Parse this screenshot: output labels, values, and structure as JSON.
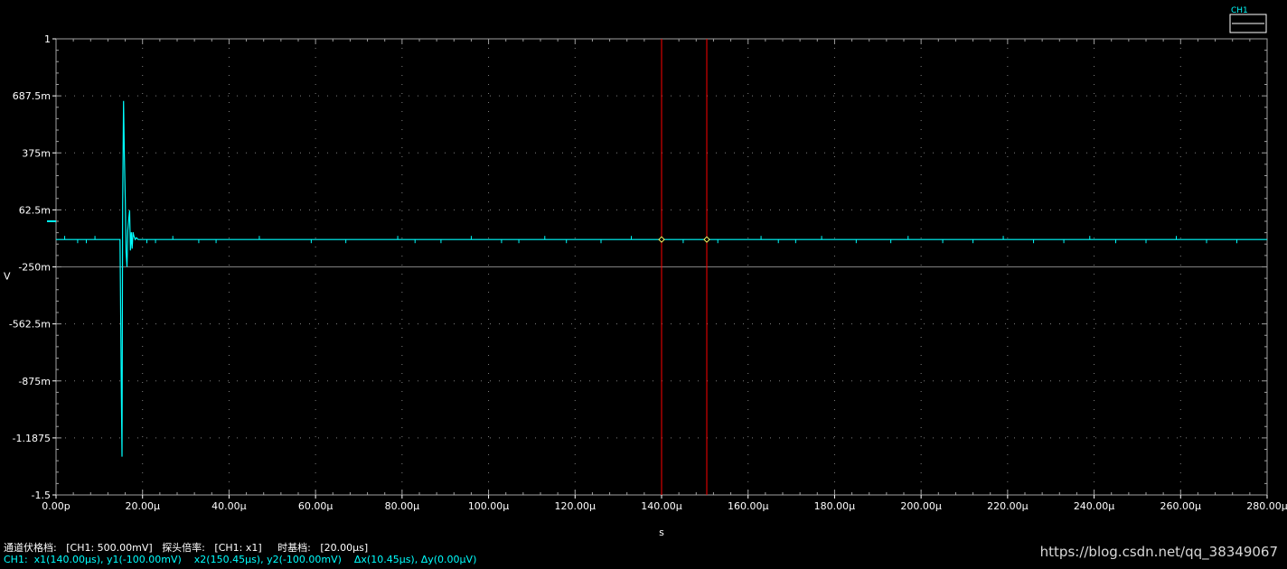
{
  "chart_data": {
    "type": "line",
    "x_unit": "s",
    "y_unit": "V",
    "xlim": [
      0,
      280
    ],
    "ylim": [
      -1.5,
      1
    ],
    "x_ticks": [
      {
        "v": 0,
        "label": "0.00p"
      },
      {
        "v": 20,
        "label": "20.00μ"
      },
      {
        "v": 40,
        "label": "40.00μ"
      },
      {
        "v": 60,
        "label": "60.00μ"
      },
      {
        "v": 80,
        "label": "80.00μ"
      },
      {
        "v": 100,
        "label": "100.00μ"
      },
      {
        "v": 120,
        "label": "120.00μ"
      },
      {
        "v": 140,
        "label": "140.00μ"
      },
      {
        "v": 160,
        "label": "160.00μ"
      },
      {
        "v": 180,
        "label": "180.00μ"
      },
      {
        "v": 200,
        "label": "200.00μ"
      },
      {
        "v": 220,
        "label": "220.00μ"
      },
      {
        "v": 240,
        "label": "240.00μ"
      },
      {
        "v": 260,
        "label": "260.00μ"
      },
      {
        "v": 280,
        "label": "280.00μ"
      }
    ],
    "y_ticks": [
      {
        "v": 1,
        "label": "1"
      },
      {
        "v": 0.6875,
        "label": "687.5m"
      },
      {
        "v": 0.375,
        "label": "375m"
      },
      {
        "v": 0.0625,
        "label": "62.5m"
      },
      {
        "v": -0.25,
        "label": "-250m"
      },
      {
        "v": -0.5625,
        "label": "-562.5m"
      },
      {
        "v": -0.875,
        "label": "-875m"
      },
      {
        "v": -1.1875,
        "label": "-1.1875"
      },
      {
        "v": -1.5,
        "label": "-1.5"
      }
    ],
    "grid": true,
    "series": [
      {
        "name": "CH1",
        "color": "#00ffff",
        "x": [
          0,
          14.8,
          14.95,
          15.1,
          15.25,
          15.4,
          15.6,
          15.8,
          16.0,
          16.2,
          16.4,
          16.6,
          16.8,
          17.0,
          17.2,
          17.4,
          17.6,
          17.8,
          18.0,
          18.3,
          18.6,
          19.0,
          140,
          150.45,
          280
        ],
        "y": [
          -0.1,
          -0.1,
          -0.5,
          -0.95,
          -1.29,
          0.08,
          0.66,
          0.36,
          0.12,
          -0.17,
          -0.25,
          -0.05,
          0.01,
          0.06,
          -0.16,
          -0.06,
          -0.15,
          -0.06,
          -0.08,
          -0.1,
          -0.09,
          -0.1,
          -0.1,
          -0.1,
          -0.1
        ],
        "noise_x": [
          2,
          5,
          7,
          9,
          21,
          23,
          27,
          33,
          37,
          47,
          59,
          67,
          79,
          83,
          89,
          96,
          103,
          107,
          113,
          118,
          126,
          133,
          145,
          153,
          163,
          167,
          171,
          177,
          185,
          193,
          197,
          205,
          212,
          219,
          226,
          233,
          239,
          245,
          252,
          259,
          266,
          273
        ]
      }
    ],
    "cursors": [
      {
        "x": 140,
        "y": -0.1,
        "color": "#ff0000"
      },
      {
        "x": 150.45,
        "y": -0.1,
        "color": "#ff0000"
      }
    ],
    "ground_marker": {
      "y": 0,
      "color": "#00ffff"
    },
    "legend": {
      "label": "CH1",
      "position": "top-right"
    }
  },
  "status": {
    "line1": {
      "vdiv_label": "通道伏格档:",
      "vdiv_value": "[CH1: 500.00mV]",
      "probe_label": "探头倍率:",
      "probe_value": "[CH1: x1]",
      "timebase_label": "时基档:",
      "timebase_value": "[20.00μs]"
    },
    "line2": {
      "channel": "CH1:",
      "x1": "x1(140.00μs),",
      "y1": "y1(-100.00mV)",
      "x2": "x2(150.45μs),",
      "y2": "y2(-100.00mV)",
      "dx": "Δx(10.45μs),",
      "dy": "Δy(0.00μV)"
    }
  },
  "watermark": "https://blog.csdn.net/qq_38349067"
}
